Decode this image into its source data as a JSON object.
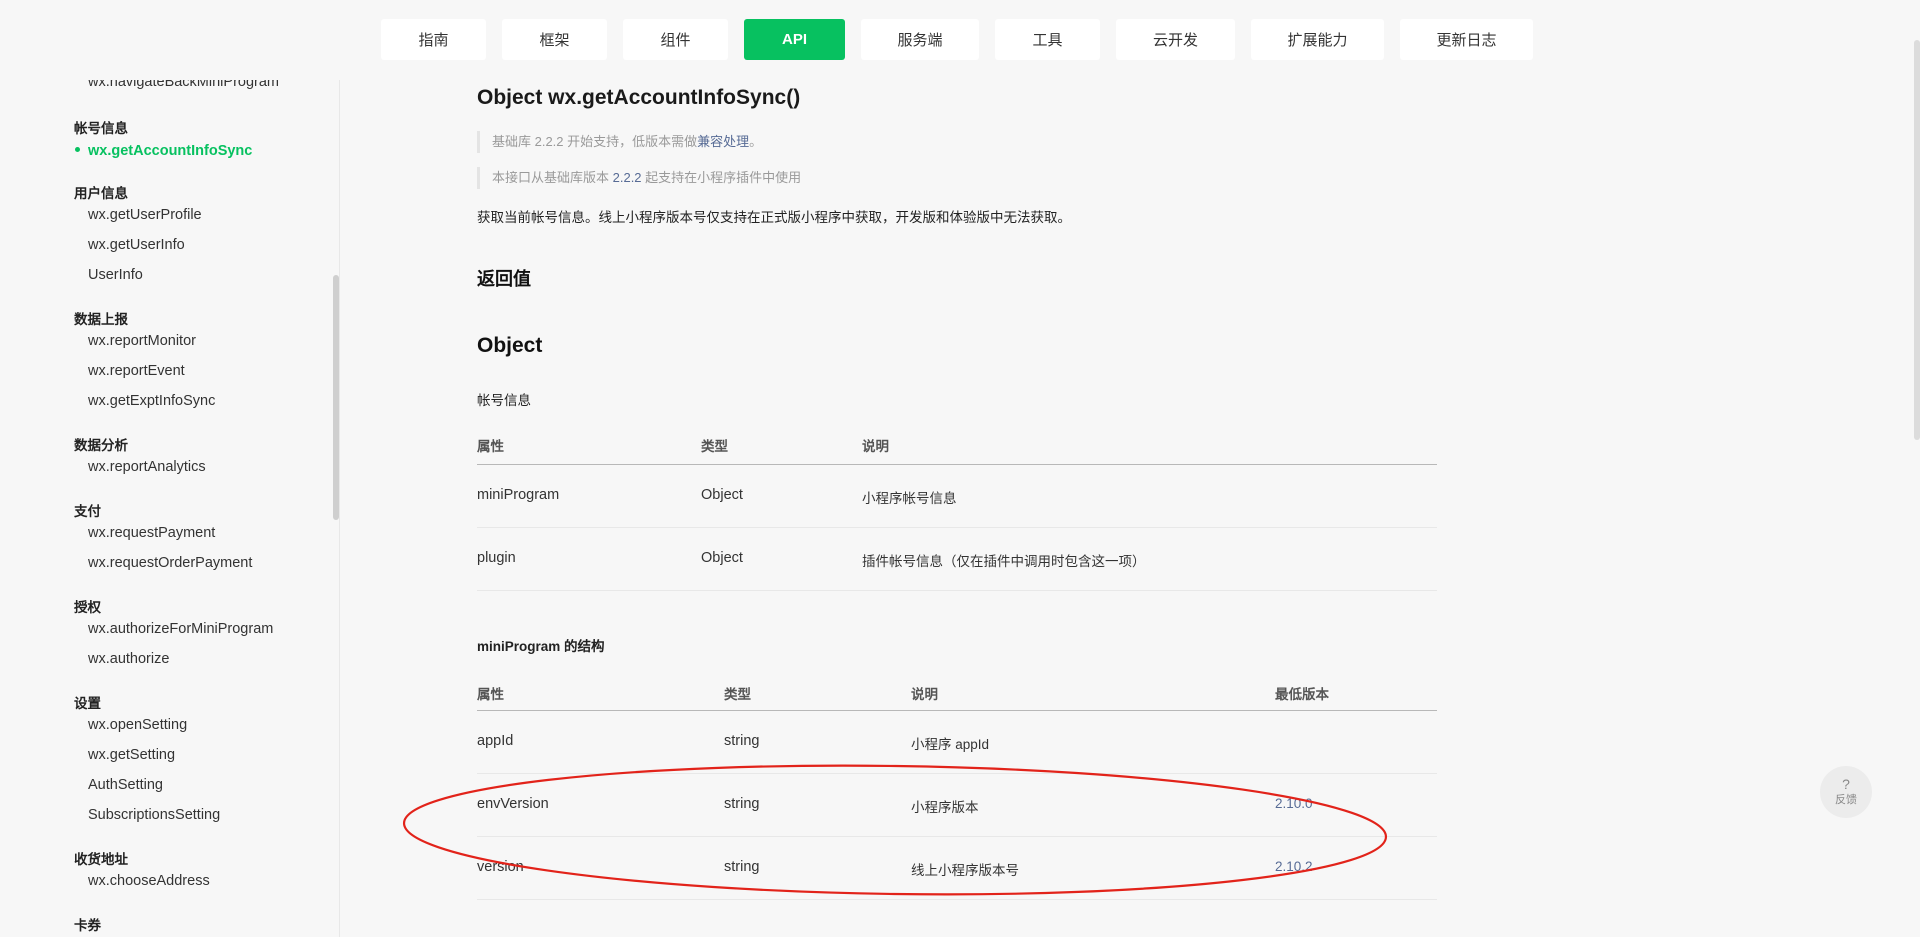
{
  "nav": {
    "items": [
      {
        "label": "指南",
        "active": false
      },
      {
        "label": "框架",
        "active": false
      },
      {
        "label": "组件",
        "active": false
      },
      {
        "label": "API",
        "active": true
      },
      {
        "label": "服务端",
        "active": false
      },
      {
        "label": "工具",
        "active": false
      },
      {
        "label": "云开发",
        "active": false
      },
      {
        "label": "扩展能力",
        "active": false
      },
      {
        "label": "更新日志",
        "active": false
      }
    ],
    "accent_color": "#07c160"
  },
  "sidebar": {
    "entries": [
      {
        "type": "item",
        "label": "wx.navigateBackMiniProgram"
      },
      {
        "type": "category",
        "label": "帐号信息"
      },
      {
        "type": "item",
        "label": "wx.getAccountInfoSync",
        "active": true
      },
      {
        "type": "category",
        "label": "用户信息"
      },
      {
        "type": "item",
        "label": "wx.getUserProfile"
      },
      {
        "type": "item",
        "label": "wx.getUserInfo"
      },
      {
        "type": "item",
        "label": "UserInfo"
      },
      {
        "type": "category",
        "label": "数据上报"
      },
      {
        "type": "item",
        "label": "wx.reportMonitor"
      },
      {
        "type": "item",
        "label": "wx.reportEvent"
      },
      {
        "type": "item",
        "label": "wx.getExptInfoSync"
      },
      {
        "type": "category",
        "label": "数据分析"
      },
      {
        "type": "item",
        "label": "wx.reportAnalytics"
      },
      {
        "type": "category",
        "label": "支付"
      },
      {
        "type": "item",
        "label": "wx.requestPayment"
      },
      {
        "type": "item",
        "label": "wx.requestOrderPayment"
      },
      {
        "type": "category",
        "label": "授权"
      },
      {
        "type": "item",
        "label": "wx.authorizeForMiniProgram"
      },
      {
        "type": "item",
        "label": "wx.authorize"
      },
      {
        "type": "category",
        "label": "设置"
      },
      {
        "type": "item",
        "label": "wx.openSetting"
      },
      {
        "type": "item",
        "label": "wx.getSetting"
      },
      {
        "type": "item",
        "label": "AuthSetting"
      },
      {
        "type": "item",
        "label": "SubscriptionsSetting"
      },
      {
        "type": "category",
        "label": "收货地址"
      },
      {
        "type": "item",
        "label": "wx.chooseAddress"
      },
      {
        "type": "category",
        "label": "卡券"
      }
    ]
  },
  "content": {
    "title": "Object wx.getAccountInfoSync()",
    "note1_prefix": "基础库 2.2.2 开始支持，低版本需做",
    "note1_link": "兼容处理",
    "note1_suffix": "。",
    "note2_prefix": "本接口从基础库版本 ",
    "note2_version": "2.2.2",
    "note2_suffix": " 起支持在小程序插件中使用",
    "description": "获取当前帐号信息。线上小程序版本号仅支持在正式版小程序中获取，开发版和体验版中无法获取。",
    "return_heading": "返回值",
    "object_heading": "Object",
    "object_caption": "帐号信息",
    "table1": {
      "headers": [
        "属性",
        "类型",
        "说明"
      ],
      "rows": [
        {
          "prop": "miniProgram",
          "type": "Object",
          "desc": "小程序帐号信息"
        },
        {
          "prop": "plugin",
          "type": "Object",
          "desc": "插件帐号信息（仅在插件中调用时包含这一项）"
        }
      ]
    },
    "struct_heading": "miniProgram 的结构",
    "table2": {
      "headers": [
        "属性",
        "类型",
        "说明",
        "最低版本"
      ],
      "rows": [
        {
          "prop": "appId",
          "type": "string",
          "desc": "小程序 appId",
          "min": ""
        },
        {
          "prop": "envVersion",
          "type": "string",
          "desc": "小程序版本",
          "min": "2.10.0"
        },
        {
          "prop": "version",
          "type": "string",
          "desc": "线上小程序版本号",
          "min": "2.10.2"
        }
      ]
    }
  },
  "feedback": {
    "icon": "?",
    "label": "反馈"
  },
  "annotation_color": "#e2231a"
}
